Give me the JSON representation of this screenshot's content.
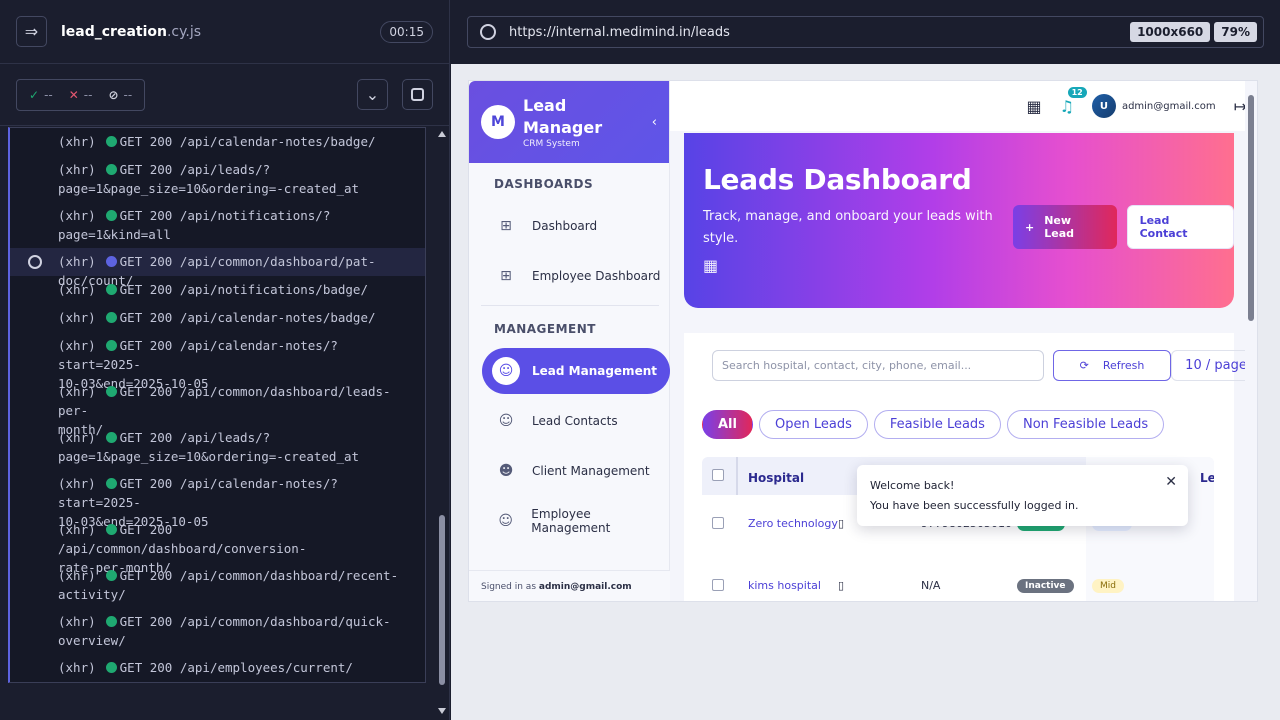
{
  "runner": {
    "spec_name": "lead_creation",
    "spec_ext": ".cy.js",
    "timer": "00:15",
    "passed": "--",
    "failed": "--",
    "pending": "--"
  },
  "commands": [
    {
      "kind": "(xhr)",
      "text": "GET 200 /api/calendar-notes/badge/"
    },
    {
      "kind": "(xhr)",
      "text": "GET 200 /api/leads/?",
      "cont": "page=1&page_size=10&ordering=-created_at"
    },
    {
      "kind": "(xhr)",
      "text": "GET 200 /api/notifications/?",
      "cont": "page=1&kind=all"
    },
    {
      "kind": "(xhr)",
      "text": "GET 200 /api/common/dashboard/pat-doc/count/",
      "active": true
    },
    {
      "kind": "(xhr)",
      "text": "GET 200 /api/notifications/badge/"
    },
    {
      "kind": "(xhr)",
      "text": "GET 200 /api/calendar-notes/badge/"
    },
    {
      "kind": "(xhr)",
      "text": "GET 200 /api/calendar-notes/?start=2025-",
      "cont": "10-03&end=2025-10-05"
    },
    {
      "kind": "(xhr)",
      "text": "GET 200 /api/common/dashboard/leads-per-",
      "cont": "month/"
    },
    {
      "kind": "(xhr)",
      "text": "GET 200 /api/leads/?",
      "cont": "page=1&page_size=10&ordering=-created_at"
    },
    {
      "kind": "(xhr)",
      "text": "GET 200 /api/calendar-notes/?start=2025-",
      "cont": "10-03&end=2025-10-05"
    },
    {
      "kind": "(xhr)",
      "text": "GET 200 /api/common/dashboard/conversion-",
      "cont": "rate-per-month/"
    },
    {
      "kind": "(xhr)",
      "text": "GET 200 /api/common/dashboard/recent-",
      "cont": "activity/"
    },
    {
      "kind": "(xhr)",
      "text": "GET 200 /api/common/dashboard/quick-",
      "cont": "overview/"
    },
    {
      "kind": "(xhr)",
      "text": "GET 200 /api/employees/current/"
    }
  ],
  "browser": {
    "url": "https://internal.medimind.in/leads",
    "viewport": "1000x660",
    "zoom": "79%"
  },
  "app": {
    "brand_title_1": "Lead",
    "brand_title_2": "Manager",
    "brand_sub": "CRM System",
    "section_dashboards": "DASHBOARDS",
    "nav_dashboard": "Dashboard",
    "nav_employee_dashboard": "Employee Dashboard",
    "section_management": "MANAGEMENT",
    "nav_lead_management": "Lead Management",
    "nav_lead_contacts": "Lead Contacts",
    "nav_client_management": "Client Management",
    "nav_employee_management": "Employee Management",
    "signed_in_prefix": "Signed in as",
    "signed_in_user": "admin@gmail.com",
    "notif_count": "12",
    "avatar_initial": "U",
    "user_email": "admin@gmail.com",
    "hero_title": "Leads Dashboard",
    "hero_sub": "Track, manage, and onboard your leads with style.",
    "btn_new_lead": "New Lead",
    "btn_lead_contact": "Lead Contact",
    "search_placeholder": "Search hospital, contact, city, phone, email...",
    "refresh": "Refresh",
    "page_size": "10 / page",
    "filters": [
      "All",
      "Open Leads",
      "Feasible Leads",
      "Non Feasible Leads"
    ],
    "col_hospital": "Hospital",
    "col_le": "Le",
    "rows": [
      {
        "hospital": "Zero technology",
        "phone": "9779802505010",
        "status": "Active",
        "tag": "Clinic"
      },
      {
        "hospital": "kims hospital",
        "phone": "N/A",
        "status": "Inactive",
        "tag": "Mid"
      }
    ],
    "toast_title": "Welcome back!",
    "toast_msg": "You have been successfully logged in."
  },
  "colors": {
    "accent": "#5b4fe6",
    "success": "#1fa971",
    "inactive": "#6b7280"
  }
}
